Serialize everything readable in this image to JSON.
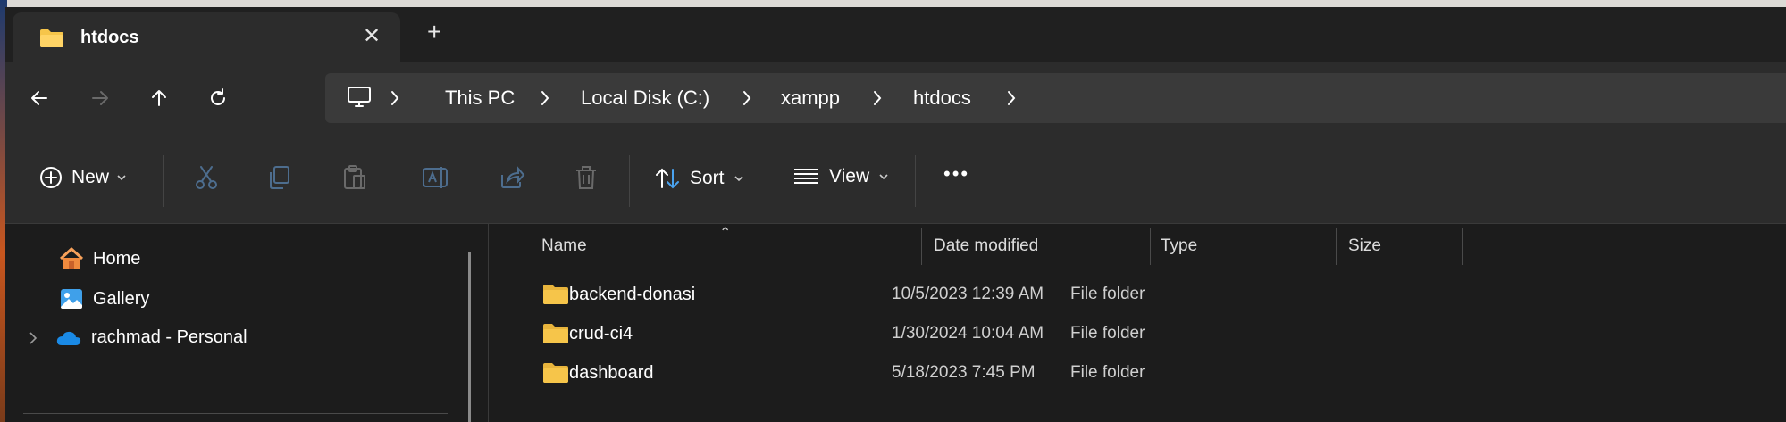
{
  "tab": {
    "title": "htdocs",
    "close_icon": "close-icon",
    "add_icon": "plus-icon"
  },
  "navigation": {
    "back_icon": "arrow-left-icon",
    "forward_icon": "arrow-right-icon",
    "up_icon": "arrow-up-icon",
    "refresh_icon": "refresh-icon"
  },
  "address_bar": {
    "root_icon": "computer-icon",
    "crumbs": [
      "This PC",
      "Local Disk (C:)",
      "xampp",
      "htdocs"
    ]
  },
  "toolbar": {
    "new_label": "New",
    "sort_label": "Sort",
    "view_label": "View",
    "more_label": "•••",
    "disabled_icons": [
      "cut-icon",
      "copy-icon",
      "paste-icon",
      "rename-icon",
      "share-icon",
      "delete-icon"
    ]
  },
  "sidebar": {
    "items": [
      {
        "label": "Home",
        "icon": "home-icon"
      },
      {
        "label": "Gallery",
        "icon": "gallery-icon"
      },
      {
        "label": "rachmad - Personal",
        "icon": "onedrive-cloud-icon",
        "expandable": true
      }
    ]
  },
  "file_list": {
    "columns": [
      "Name",
      "Date modified",
      "Type",
      "Size"
    ],
    "sorted_column": "Name",
    "rows": [
      {
        "name": "backend-donasi",
        "date": "10/5/2023 12:39 AM",
        "type": "File folder",
        "size": ""
      },
      {
        "name": "crud-ci4",
        "date": "1/30/2024 10:04 AM",
        "type": "File folder",
        "size": ""
      },
      {
        "name": "dashboard",
        "date": "5/18/2023 7:45 PM",
        "type": "File folder",
        "size": ""
      }
    ]
  },
  "colors": {
    "folder": "#f6c54a",
    "accent": "#4aa3f0",
    "background": "#1c1c1c"
  }
}
